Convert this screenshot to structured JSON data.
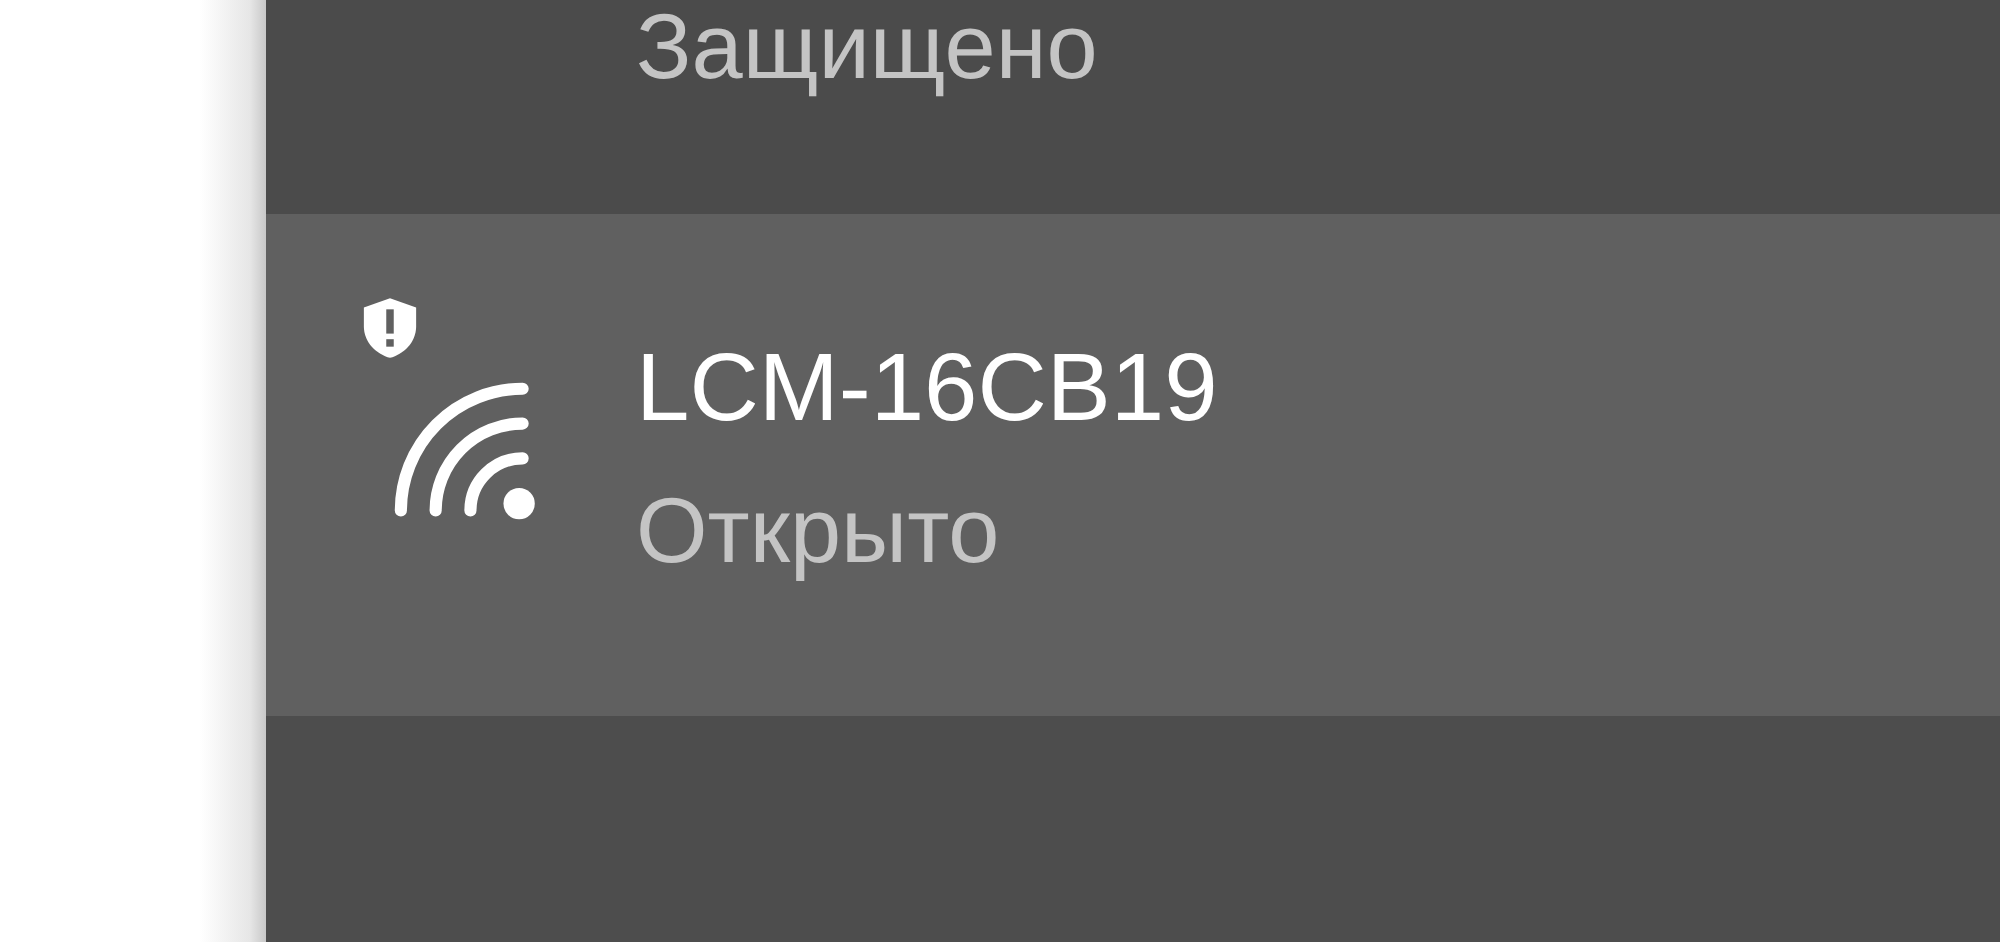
{
  "networks": [
    {
      "status": "Защищено",
      "selected": false
    },
    {
      "name": "LCM-16CB19",
      "status": "Открыто",
      "selected": true,
      "warning": true
    }
  ]
}
